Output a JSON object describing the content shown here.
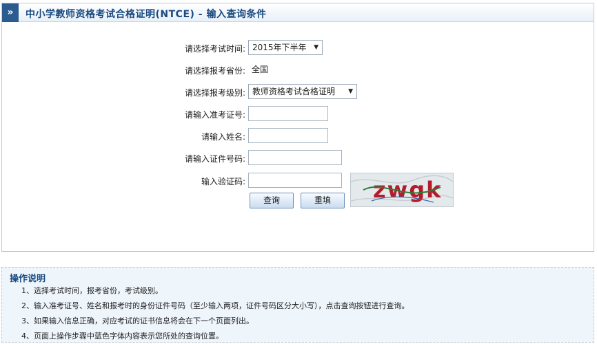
{
  "header": {
    "icon": "double-chevron-right-icon",
    "title": "中小学教师资格考试合格证明(NTCE) - 输入查询条件"
  },
  "form": {
    "exam_time": {
      "label": "请选择考试时间:",
      "value": "2015年下半年"
    },
    "province": {
      "label": "请选择报考省份:",
      "value": "全国"
    },
    "level": {
      "label": "请选择报考级别:",
      "value": "教师资格考试合格证明"
    },
    "admission_no": {
      "label": "请输入准考证号:",
      "value": ""
    },
    "name": {
      "label": "请输入姓名:",
      "value": ""
    },
    "id_no": {
      "label": "请输入证件号码:",
      "value": ""
    },
    "captcha": {
      "label": "输入验证码:",
      "value": "",
      "image_text": "zwgk"
    },
    "query_button": "查询",
    "reset_button": "重填"
  },
  "help": {
    "title": "操作说明",
    "items": [
      "1、选择考试时间，报考省份，考试级别。",
      "2、输入准考证号、姓名和报考时的身份证件号码（至少输入两项，证件号码区分大小写），点击查询按钮进行查询。",
      "3、如果输入信息正确，对应考试的证书信息将会在下一个页面列出。",
      "4、页面上操作步骤中蓝色字体内容表示您所处的查询位置。"
    ]
  }
}
